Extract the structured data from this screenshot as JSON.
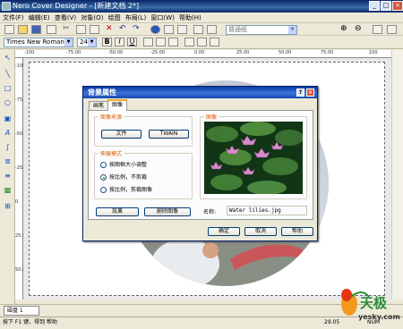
{
  "window": {
    "title": "Nero Cover Designer - [新建文档 2*]"
  },
  "menu": [
    "文件(F)",
    "编辑(E)",
    "查看(V)",
    "对象(O)",
    "绘图",
    "布局(L)",
    "窗口(W)",
    "帮助(H)"
  ],
  "toolbar": {
    "style_combo": "普通纸",
    "font": "Times New Roman",
    "size": "24"
  },
  "ruler": {
    "h_labels": [
      "-100",
      "-75.00",
      "-50.00",
      "-25.00",
      "0.00",
      "25.00",
      "50.00",
      "75.00",
      "100"
    ],
    "v_labels": [
      "-100",
      "-75.00",
      "-50.00",
      "-25.00",
      "0",
      "25.00",
      "50.00"
    ]
  },
  "doc_tab": "磁盘 1",
  "status": {
    "hint": "按下 F1 键，得到 帮助",
    "coords": "29.05",
    "mode": "NUM"
  },
  "dialog": {
    "title": "背景属性",
    "tabs": [
      "画笔",
      "图像"
    ],
    "source_group": "图像来源",
    "file_button": "文件",
    "twain_button": "TWAIN",
    "mode_group": "伸展模式",
    "options": [
      "按图框大小调整",
      "按比例，不剪裁",
      "按比例，剪裁图像"
    ],
    "selected_option": 1,
    "effect_button": "效果",
    "remove_button": "删除图像",
    "preview_group": "图像",
    "name_label": "名称:",
    "name_value": "Water lilies.jpg",
    "ok": "确定",
    "cancel": "取消",
    "help": "帮助"
  },
  "watermark": {
    "text": "天极",
    "sub": "yesky.com"
  },
  "colors": {
    "title_bar": "#0a246a",
    "group_title": "#e25a00"
  }
}
